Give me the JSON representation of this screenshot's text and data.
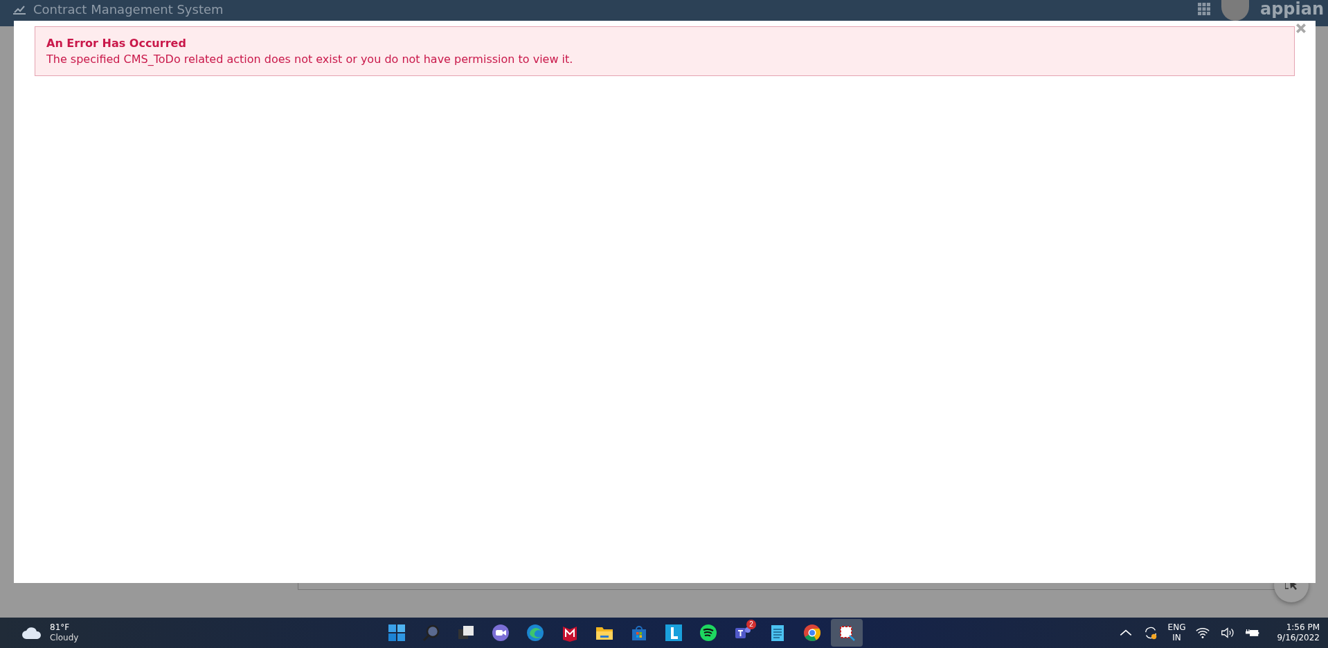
{
  "app_header": {
    "title": "Contract Management System",
    "logo_text": "appian"
  },
  "dialog": {
    "error": {
      "title": "An Error Has Occurred",
      "message": "The specified CMS_ToDo related action does not exist or you do not have permission to view it."
    }
  },
  "taskbar": {
    "weather": {
      "temperature": "81°F",
      "condition": "Cloudy"
    },
    "apps": [
      {
        "selected": false
      },
      {
        "selected": false
      },
      {
        "selected": false
      },
      {
        "selected": false
      },
      {
        "selected": false
      },
      {
        "selected": false
      },
      {
        "selected": false
      },
      {
        "selected": false
      },
      {
        "selected": false
      },
      {
        "selected": false
      },
      {
        "selected": false,
        "badge": "2"
      },
      {
        "selected": false
      },
      {
        "selected": false
      },
      {
        "selected": true
      }
    ],
    "language": {
      "code": "ENG",
      "region": "IN"
    },
    "clock": {
      "time": "1:56 PM",
      "date": "9/16/2022"
    }
  }
}
